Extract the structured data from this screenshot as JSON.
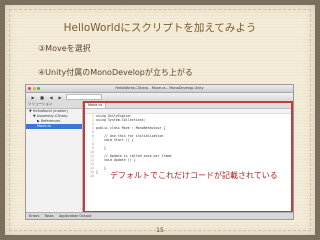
{
  "slide": {
    "title": "HelloWorldにスクリプトを加えてみよう",
    "step1": "③Moveを選択",
    "step2": "④Unity付属のMonoDevelopが立ち上がる",
    "callout": "デフォルトでこれだけコードが記載されている",
    "page_number": "15"
  },
  "app": {
    "window_title": "HelloWorld-CSharp - Move.cs - MonoDevelop-Unity",
    "toolbar": {
      "buttons": [
        "▶",
        "■",
        "◀",
        "▶"
      ]
    },
    "solution": {
      "header": "ソリューション",
      "items": [
        {
          "label": "▼ HelloWorld (master)",
          "indent": 0,
          "selected": false
        },
        {
          "label": "▼ Assembly-CSharp",
          "indent": 1,
          "selected": false
        },
        {
          "label": "▶ References",
          "indent": 2,
          "selected": false
        },
        {
          "label": "Move.cs",
          "indent": 2,
          "selected": true
        }
      ]
    },
    "editor": {
      "tab": "Move.cs",
      "code_lines": [
        "using UnityEngine;",
        "using System.Collections;",
        "",
        "public class Move : MonoBehaviour {",
        "",
        "    // Use this for initialization",
        "    void Start () {",
        "",
        "    }",
        "",
        "    // Update is called once per frame",
        "    void Update () {",
        "",
        "    }",
        "}",
        ""
      ]
    },
    "status": {
      "items": [
        "Errors",
        "Tasks",
        "Application Output"
      ]
    }
  }
}
